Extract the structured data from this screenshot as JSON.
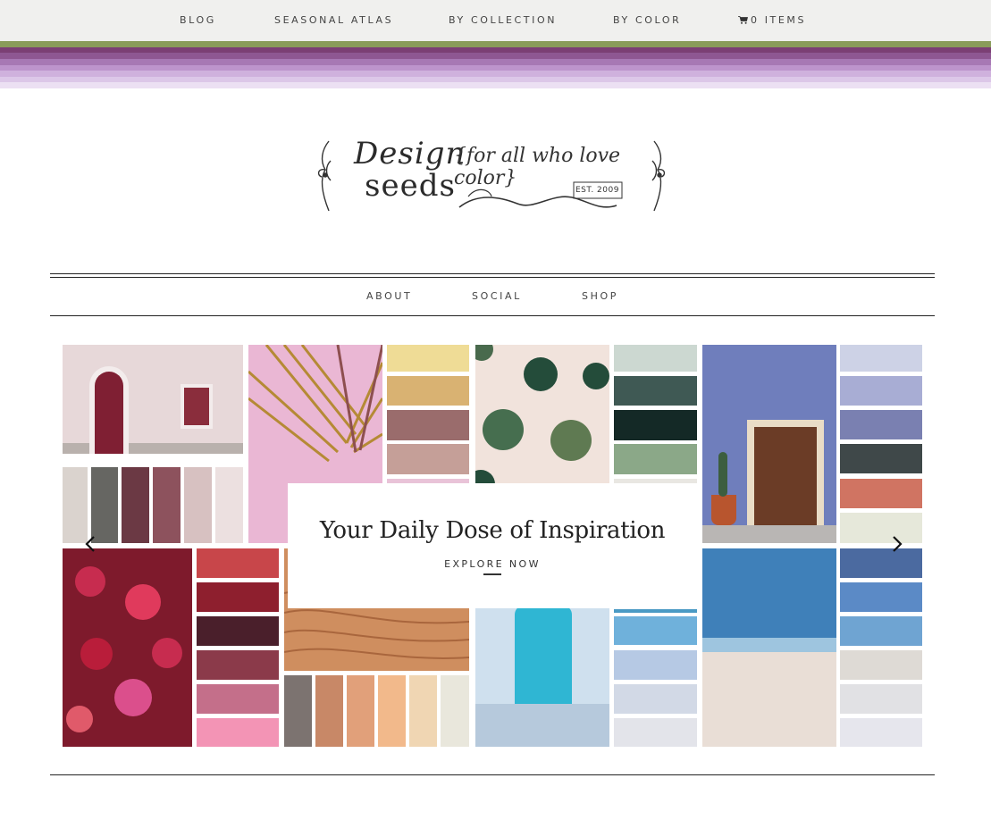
{
  "topnav": {
    "items": [
      "BLOG",
      "SEASONAL ATLAS",
      "BY COLLECTION",
      "BY COLOR"
    ],
    "cart_label": "0 ITEMS"
  },
  "stripes": [
    "#8a9c5a",
    "#7b3f74",
    "#8e5792",
    "#a778b4",
    "#bd94cc",
    "#cfb1dd",
    "#dcc7e8",
    "#ece0f3"
  ],
  "subnav": {
    "items": [
      "ABOUT",
      "SOCIAL",
      "SHOP"
    ]
  },
  "hero": {
    "title": "Your Daily Dose of Inspiration",
    "cta": "EXPLORE NOW"
  },
  "colors": {
    "nav_bg": "#f0f0ee",
    "rule": "#222222"
  },
  "icons": {
    "cart": "cart-icon",
    "prev": "chevron-left-icon",
    "next": "chevron-right-icon"
  }
}
